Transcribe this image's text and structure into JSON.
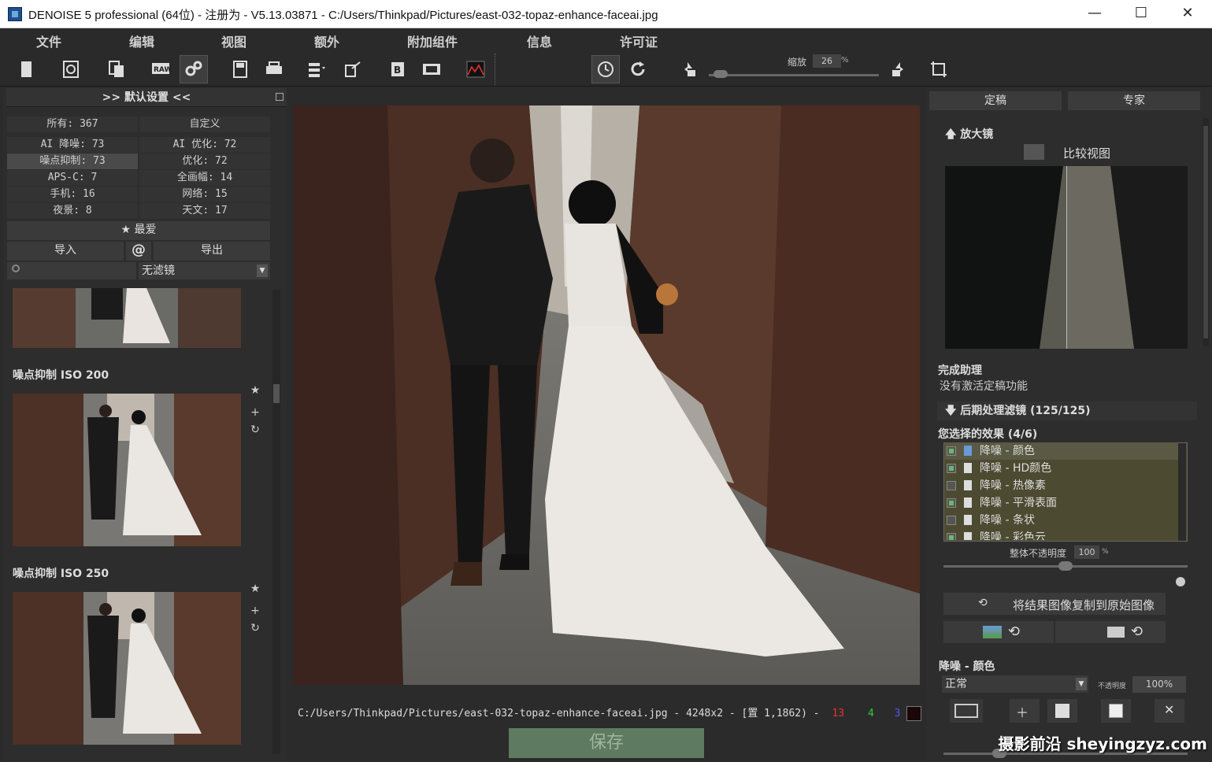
{
  "window": {
    "title": "DENOISE 5 professional (64位) - 注册为 - V5.13.03871 - C:/Users/Thinkpad/Pictures/east-032-topaz-enhance-faceai.jpg",
    "minimize": "—",
    "maximize": "☐",
    "close": "✕"
  },
  "menu": [
    "文件",
    "编辑",
    "视图",
    "额外",
    "附加组件",
    "信息",
    "许可证"
  ],
  "toolbar": {
    "zoom_label": "缩放",
    "zoom_value": "26",
    "zoom_unit": "%",
    "zoom_level": 0.03
  },
  "left": {
    "header": ">> 默认设置 <<",
    "categories": [
      [
        "所有: 367",
        "自定义"
      ],
      [
        "AI 降噪: 73",
        "AI 优化: 72"
      ],
      [
        "噪点抑制: 73",
        "优化: 72"
      ],
      [
        "APS-C: 7",
        "全画幅: 14"
      ],
      [
        "手机: 16",
        "网络: 15"
      ],
      [
        "夜景: 8",
        "天文: 17"
      ]
    ],
    "favorites": "★ 最爱",
    "import": "导入",
    "at": "@",
    "export": "导出",
    "filter": "无滤镜",
    "presets": [
      {
        "title": "噪点抑制 ISO 200"
      },
      {
        "title": "噪点抑制 ISO 250"
      }
    ]
  },
  "status": {
    "path": "C:/Users/Thinkpad/Pictures/east-032-topaz-enhance-faceai.jpg - 4248x2 - [置 1,1862) -",
    "r": "13",
    "g": "4",
    "b": "3"
  },
  "save": "保存",
  "right": {
    "tabs": [
      "定稿",
      "专家"
    ],
    "magnifier": "放大镜",
    "compare": "比较视图",
    "assistant_title": "完成助理",
    "assistant_text": "没有激活定稿功能",
    "post_filters": "后期处理滤镜 (125/125)",
    "effects_title": "您选择的效果 (4/6)",
    "effects": [
      {
        "label": "降噪 - 颜色",
        "on": true
      },
      {
        "label": "降噪 - HD颜色",
        "on": true
      },
      {
        "label": "降噪 - 热像素",
        "on": false
      },
      {
        "label": "降噪 - 平滑表面",
        "on": true
      },
      {
        "label": "降噪 - 条状",
        "on": false
      },
      {
        "label": "降噪 - 彩色云",
        "on": true
      }
    ],
    "opacity_label": "整体不透明度",
    "opacity_value": "100",
    "opacity_unit": "%",
    "copy_to_original": "将结果图像复制到原始图像",
    "effect_section": "降噪 - 颜色",
    "blend_mode": "正常",
    "blend_opacity_label": "不透明度",
    "blend_opacity": "100%"
  },
  "watermark": "摄影前沿 sheyingzyz.com"
}
